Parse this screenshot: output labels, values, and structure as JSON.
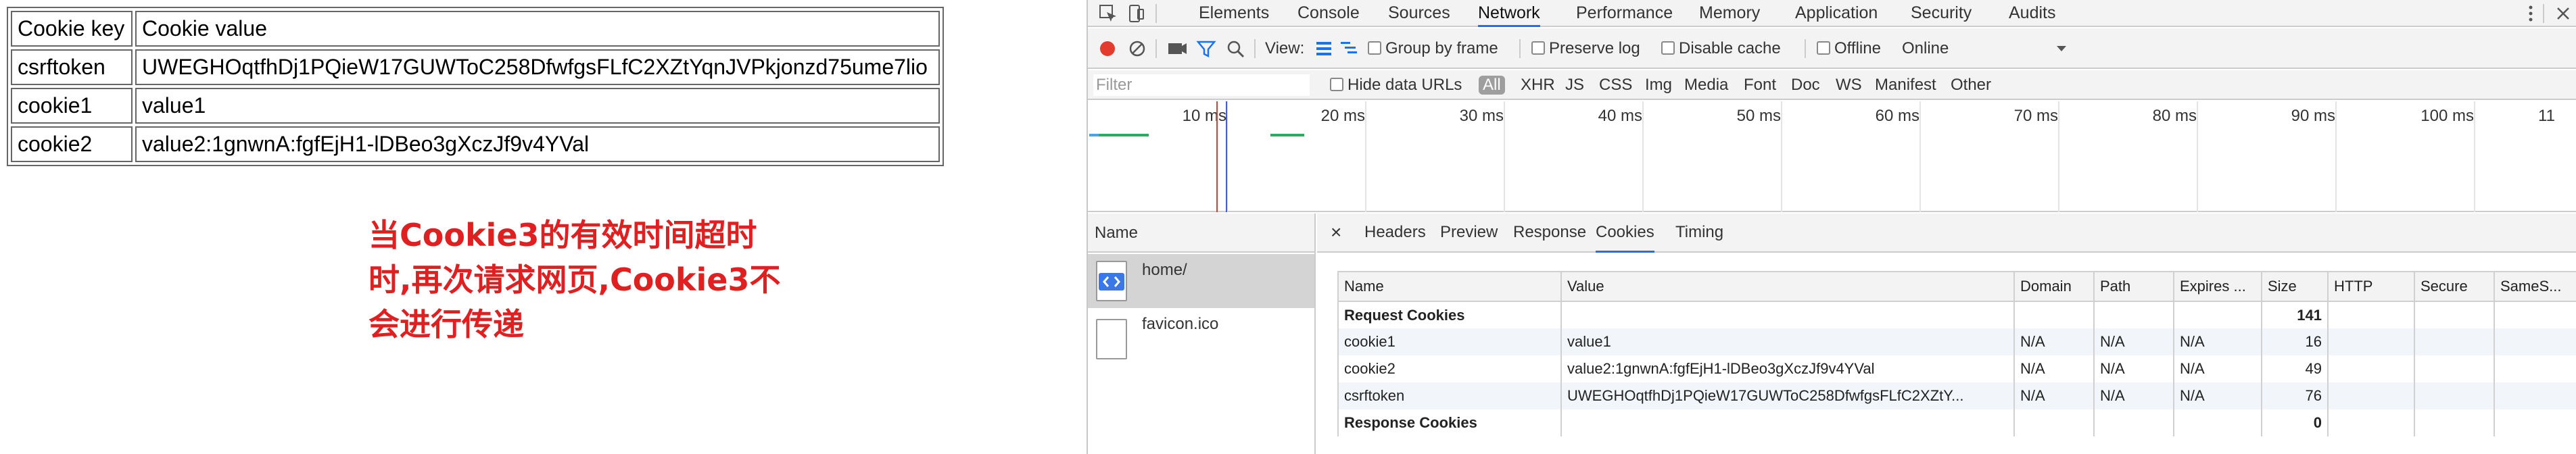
{
  "page": {
    "table_headers": {
      "key": "Cookie key",
      "value": "Cookie value"
    },
    "rows": [
      {
        "key": "csrftoken",
        "value": "UWEGHOqtfhDj1PQieW17GUWToC258DfwfgsFLfC2XZtYqnJVPkjonzd75ume7lio"
      },
      {
        "key": "cookie1",
        "value": "value1"
      },
      {
        "key": "cookie2",
        "value": "value2:1gnwnA:fgfEjH1-lDBeo3gXczJf9v4YVal"
      }
    ],
    "annotation_lines": [
      "当Cookie3的有效时间超时",
      "时,再次请求网页,Cookie3不",
      "会进行传递"
    ],
    "annotation_color": "#e02020"
  },
  "devtools": {
    "tabs": [
      "Elements",
      "Console",
      "Sources",
      "Network",
      "Performance",
      "Memory",
      "Application",
      "Security",
      "Audits"
    ],
    "active_tab": "Network",
    "toolbar": {
      "view_label": "View:",
      "group_by_frame": "Group by frame",
      "preserve_log": "Preserve log",
      "disable_cache": "Disable cache",
      "offline": "Offline",
      "throttle": "Online"
    },
    "filter": {
      "placeholder": "Filter",
      "hide_data_urls": "Hide data URLs",
      "types": [
        "All",
        "XHR",
        "JS",
        "CSS",
        "Img",
        "Media",
        "Font",
        "Doc",
        "WS",
        "Manifest",
        "Other"
      ]
    },
    "timeline_ticks": [
      "10 ms",
      "20 ms",
      "30 ms",
      "40 ms",
      "50 ms",
      "60 ms",
      "70 ms",
      "80 ms",
      "90 ms",
      "100 ms",
      "11"
    ],
    "sidebar": {
      "header": "Name",
      "items": [
        {
          "name": "home/"
        },
        {
          "name": "favicon.ico"
        }
      ]
    },
    "detail_tabs": [
      "×",
      "Headers",
      "Preview",
      "Response",
      "Cookies",
      "Timing"
    ],
    "active_detail_tab": "Cookies",
    "cookie_table": {
      "columns": [
        "Name",
        "Value",
        "Domain",
        "Path",
        "Expires ...",
        "Size",
        "HTTP",
        "Secure",
        "SameS..."
      ],
      "request_group": {
        "label": "Request Cookies",
        "size": "141"
      },
      "rows": [
        {
          "name": "cookie1",
          "value": "value1",
          "domain": "N/A",
          "path": "N/A",
          "expires": "N/A",
          "size": "16"
        },
        {
          "name": "cookie2",
          "value": "value2:1gnwnA:fgfEjH1-lDBeo3gXczJf9v4YVal",
          "domain": "N/A",
          "path": "N/A",
          "expires": "N/A",
          "size": "49"
        },
        {
          "name": "csrftoken",
          "value": "UWEGHOqtfhDj1PQieW17GUWToC258DfwfgsFLfC2XZtY...",
          "domain": "N/A",
          "path": "N/A",
          "expires": "N/A",
          "size": "76"
        }
      ],
      "response_group": {
        "label": "Response Cookies",
        "size": "0"
      }
    },
    "accent_color": "#1a73e8",
    "record_color": "#e33b2e"
  }
}
